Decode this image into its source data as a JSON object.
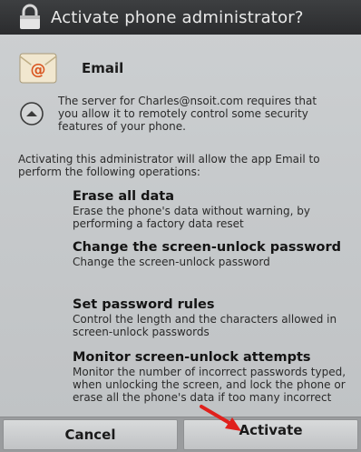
{
  "dialog": {
    "title": "Activate phone administrator?"
  },
  "app": {
    "name": "Email",
    "icon": "at-sign-envelope-icon"
  },
  "description": "The server for Charles@nsoit.com requires that you allow it to remotely control some security features of your phone.",
  "intro": "Activating this administrator will allow the app Email to perform the following operations:",
  "permissions": [
    {
      "title": "Erase all data",
      "description": "Erase the phone's data without warning, by performing a factory data reset"
    },
    {
      "title": "Change the screen-unlock password",
      "description": "Change the screen-unlock password"
    },
    {
      "title": "Set password rules",
      "description": "Control the length and the characters allowed in screen-unlock passwords"
    },
    {
      "title": "Monitor screen-unlock attempts",
      "description": "Monitor the number of incorrect passwords typed, when unlocking the screen, and lock the phone or erase all the phone's data if too many incorrect"
    }
  ],
  "buttons": {
    "cancel": "Cancel",
    "activate": "Activate"
  },
  "colors": {
    "title_bar": "#2b2c2e",
    "background": "#c6c9cb",
    "annotation_arrow": "#e0201c"
  }
}
